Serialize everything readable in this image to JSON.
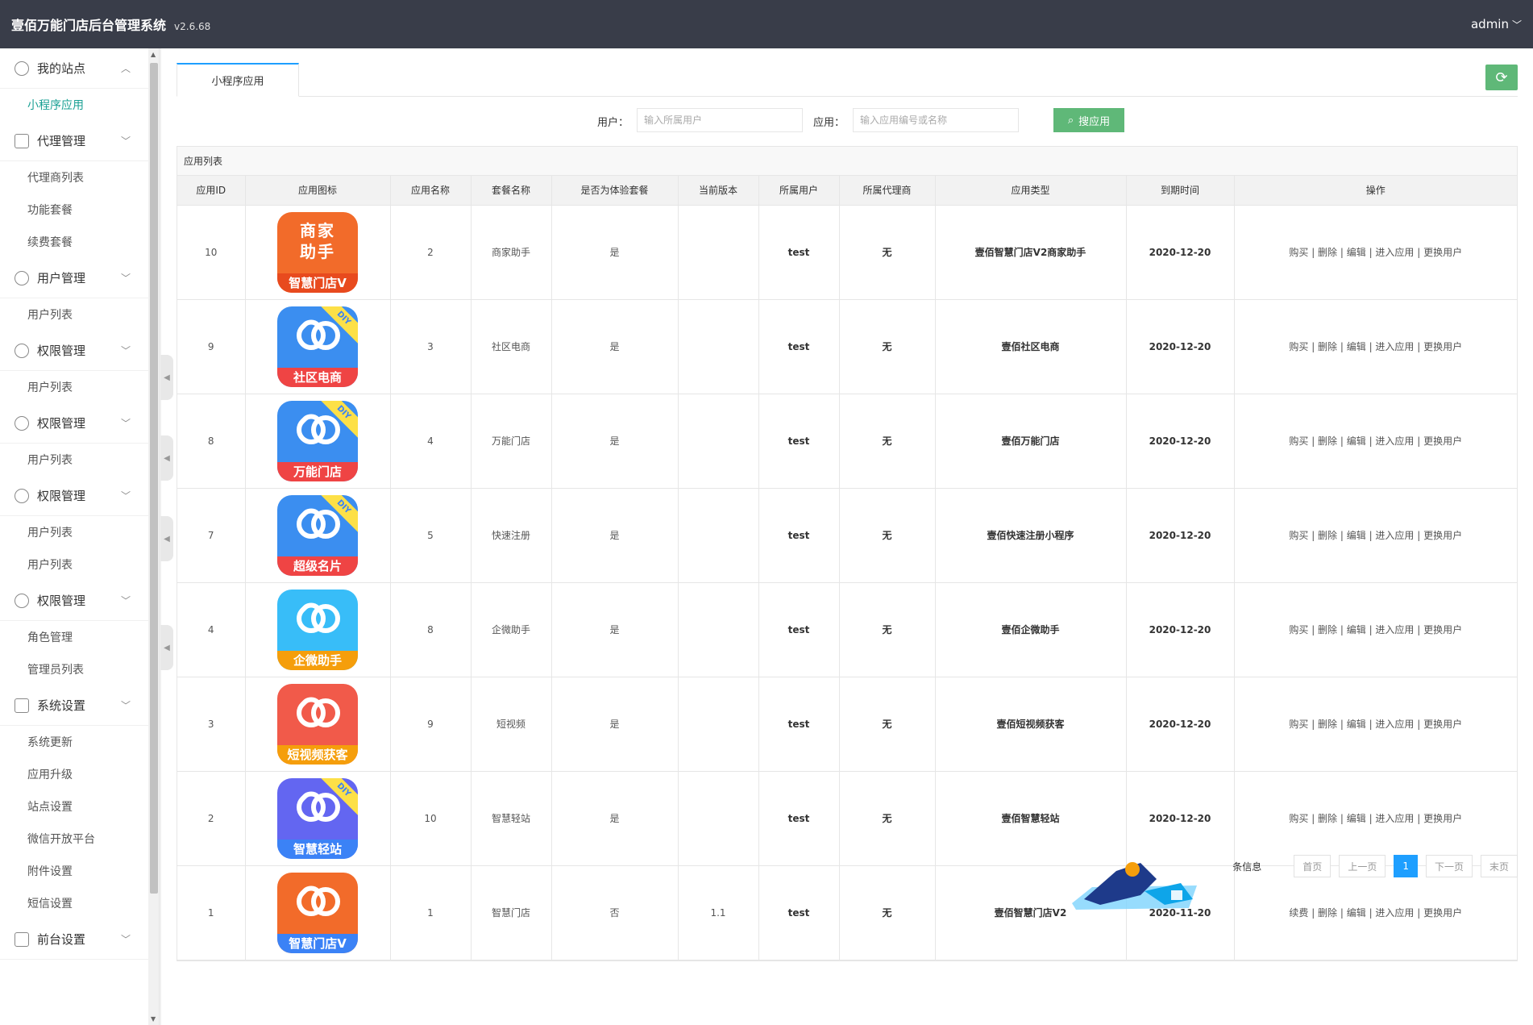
{
  "header": {
    "title": "壹佰万能门店后台管理系统",
    "version": "v2.6.68",
    "user": "admin"
  },
  "sidebar": {
    "items": [
      {
        "type": "group",
        "label": "我的站点",
        "icon": "user-icon",
        "arrow": "︿",
        "open": true
      },
      {
        "type": "sub",
        "label": "小程序应用",
        "active": true
      },
      {
        "type": "group",
        "label": "代理管理",
        "icon": "bag-icon",
        "arrow": "﹀"
      },
      {
        "type": "sub",
        "label": "代理商列表"
      },
      {
        "type": "sub",
        "label": "功能套餐"
      },
      {
        "type": "sub",
        "label": "续费套餐"
      },
      {
        "type": "group",
        "label": "用户管理",
        "icon": "users-icon",
        "arrow": "﹀"
      },
      {
        "type": "sub",
        "label": "用户列表"
      },
      {
        "type": "group",
        "label": "权限管理",
        "icon": "gear-icon",
        "arrow": "﹀"
      },
      {
        "type": "sub",
        "label": "用户列表"
      },
      {
        "type": "group",
        "label": "权限管理",
        "icon": "gear-icon",
        "arrow": "﹀"
      },
      {
        "type": "sub",
        "label": "用户列表"
      },
      {
        "type": "group",
        "label": "权限管理",
        "icon": "gear-icon",
        "arrow": "﹀"
      },
      {
        "type": "sub",
        "label": "用户列表"
      },
      {
        "type": "sub",
        "label": "用户列表"
      },
      {
        "type": "group",
        "label": "权限管理",
        "icon": "gear-icon",
        "arrow": "﹀"
      },
      {
        "type": "sub",
        "label": "角色管理"
      },
      {
        "type": "sub",
        "label": "管理员列表"
      },
      {
        "type": "group",
        "label": "系统设置",
        "icon": "doc-icon",
        "arrow": "﹀"
      },
      {
        "type": "sub",
        "label": "系统更新"
      },
      {
        "type": "sub",
        "label": "应用升级"
      },
      {
        "type": "sub",
        "label": "站点设置"
      },
      {
        "type": "sub",
        "label": "微信开放平台"
      },
      {
        "type": "sub",
        "label": "附件设置"
      },
      {
        "type": "sub",
        "label": "短信设置"
      },
      {
        "type": "group",
        "label": "前台设置",
        "icon": "doc-icon",
        "arrow": "﹀"
      }
    ]
  },
  "tabs": [
    {
      "label": "小程序应用"
    }
  ],
  "search": {
    "user_label": "用户：",
    "user_placeholder": "输入所属用户",
    "app_label": "应用：",
    "app_placeholder": "输入应用编号或名称",
    "button": "搜应用"
  },
  "panel_title": "应用列表",
  "columns": [
    "应用ID",
    "应用图标",
    "应用名称",
    "套餐名称",
    "是否为体验套餐",
    "当前版本",
    "所属用户",
    "所属代理商",
    "应用类型",
    "到期时间",
    "操作"
  ],
  "rows": [
    {
      "id": "10",
      "icon": {
        "style": "text",
        "text": "商家\n助手",
        "band": "智慧门店V",
        "bg": "#f26b2a",
        "band_bg": "#e84a1e",
        "diy": false
      },
      "name": "2",
      "package": "商家助手",
      "trial": "是",
      "version": "",
      "user": "test",
      "agent": "无",
      "type": "壹佰智慧门店V2商家助手",
      "expire": "2020-12-20",
      "ops": [
        "购买",
        "删除",
        "编辑",
        "进入应用",
        "更换用户"
      ]
    },
    {
      "id": "9",
      "icon": {
        "style": "logo",
        "band": "社区电商",
        "bg": "#3b8ef0",
        "band_bg": "#ef4444",
        "diy": true
      },
      "name": "3",
      "package": "社区电商",
      "trial": "是",
      "version": "",
      "user": "test",
      "agent": "无",
      "type": "壹佰社区电商",
      "expire": "2020-12-20",
      "ops": [
        "购买",
        "删除",
        "编辑",
        "进入应用",
        "更换用户"
      ]
    },
    {
      "id": "8",
      "icon": {
        "style": "logo",
        "band": "万能门店",
        "bg": "#3b8ef0",
        "band_bg": "#ef4444",
        "diy": true
      },
      "name": "4",
      "package": "万能门店",
      "trial": "是",
      "version": "",
      "user": "test",
      "agent": "无",
      "type": "壹佰万能门店",
      "expire": "2020-12-20",
      "ops": [
        "购买",
        "删除",
        "编辑",
        "进入应用",
        "更换用户"
      ]
    },
    {
      "id": "7",
      "icon": {
        "style": "logo",
        "band": "超级名片",
        "bg": "#3b8ef0",
        "band_bg": "#ef4444",
        "diy": true
      },
      "name": "5",
      "package": "快速注册",
      "trial": "是",
      "version": "",
      "user": "test",
      "agent": "无",
      "type": "壹佰快速注册小程序",
      "expire": "2020-12-20",
      "ops": [
        "购买",
        "删除",
        "编辑",
        "进入应用",
        "更换用户"
      ]
    },
    {
      "id": "4",
      "icon": {
        "style": "logo",
        "band": "企微助手",
        "bg": "#38bdf8",
        "band_bg": "#f59e0b",
        "diy": false
      },
      "name": "8",
      "package": "企微助手",
      "trial": "是",
      "version": "",
      "user": "test",
      "agent": "无",
      "type": "壹佰企微助手",
      "expire": "2020-12-20",
      "ops": [
        "购买",
        "删除",
        "编辑",
        "进入应用",
        "更换用户"
      ]
    },
    {
      "id": "3",
      "icon": {
        "style": "logo",
        "band": "短视频获客",
        "bg": "#f15a4a",
        "band_bg": "#f59e0b",
        "diy": false
      },
      "name": "9",
      "package": "短视频",
      "trial": "是",
      "version": "",
      "user": "test",
      "agent": "无",
      "type": "壹佰短视频获客",
      "expire": "2020-12-20",
      "ops": [
        "购买",
        "删除",
        "编辑",
        "进入应用",
        "更换用户"
      ]
    },
    {
      "id": "2",
      "icon": {
        "style": "logo",
        "band": "智慧轻站",
        "bg": "#6366f1",
        "band_bg": "#3b82f6",
        "diy": true
      },
      "name": "10",
      "package": "智慧轻站",
      "trial": "是",
      "version": "",
      "user": "test",
      "agent": "无",
      "type": "壹佰智慧轻站",
      "expire": "2020-12-20",
      "ops": [
        "购买",
        "删除",
        "编辑",
        "进入应用",
        "更换用户"
      ]
    },
    {
      "id": "1",
      "icon": {
        "style": "logo",
        "band": "智慧门店V",
        "bg": "#f26b2a",
        "band_bg": "#3b82f6",
        "diy": false
      },
      "name": "1",
      "package": "智慧门店",
      "trial": "否",
      "version": "1.1",
      "user": "test",
      "agent": "无",
      "type": "壹佰智慧门店V2",
      "expire": "2020-11-20",
      "ops": [
        "续费",
        "删除",
        "编辑",
        "进入应用",
        "更换用户"
      ]
    }
  ],
  "pager": {
    "info": "条信息",
    "first": "首页",
    "prev": "上一页",
    "current": "1",
    "next": "下一页",
    "last": "末页"
  },
  "colors": {
    "topbar": "#393d49",
    "accent": "#1aa094",
    "green": "#5fb878",
    "blue": "#1e9fff"
  }
}
